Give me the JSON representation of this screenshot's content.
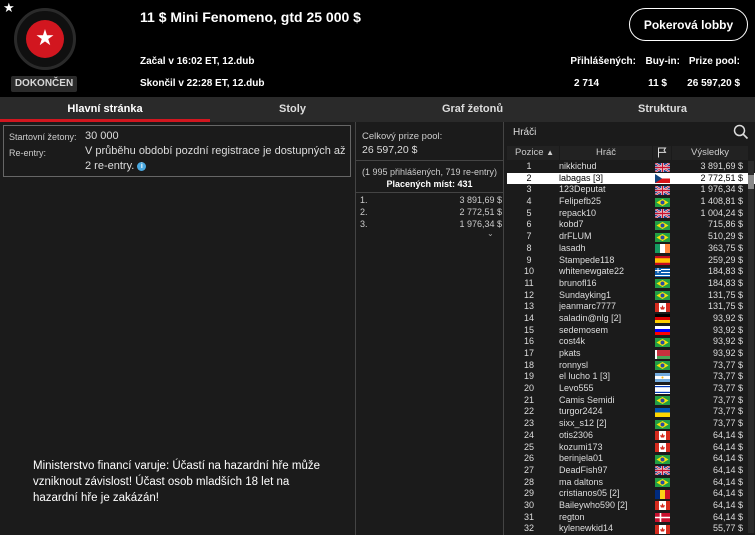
{
  "header": {
    "title": "11 $ Mini Fenomeno,  gtd 25 000 $",
    "status": "DOKONČEN",
    "started": "Začal v 16:02 ET, 12.dub",
    "ended": "Skončil v 22:28 ET, 12.dub",
    "lobby_button": "Pokerová lobby",
    "stats": {
      "registered_label": "Přihlášených:",
      "registered_value": "2 714",
      "buyin_label": "Buy-in:",
      "buyin_value": "11 $",
      "prizepool_label": "Prize pool:",
      "prizepool_value": "26 597,20 $"
    }
  },
  "tabs": [
    "Hlavní stránka",
    "Stoly",
    "Graf žetonů",
    "Struktura"
  ],
  "info": {
    "chips_label": "Startovní žetony:",
    "chips_value": "30 000",
    "reentry_label": "Re-entry:",
    "reentry_line1": "V průběhu období pozdní registrace je dostupných až",
    "reentry_line2": "2 re-entry."
  },
  "warning": "Ministerstvo financí varuje: Účastí na hazardní hře může vzniknout závislost! Účast osob mladších 18 let na hazardní hře je zakázán!",
  "prize_panel": {
    "title": "Celkový prize pool:",
    "amount": "26 597,20 $",
    "note": "(1 995 přihlášených, 719 re-entry)",
    "places": "Placených míst: 431",
    "rows": [
      {
        "rank": "1.",
        "value": "3 891,69 $"
      },
      {
        "rank": "2.",
        "value": "2 772,51 $"
      },
      {
        "rank": "3.",
        "value": "1 976,34 $"
      }
    ]
  },
  "players": {
    "title": "Hráči",
    "col_position": "Pozice",
    "col_player": "Hráč",
    "col_results": "Výsledky",
    "rows": [
      {
        "pos": "1",
        "name": "nikkichud",
        "flag": "gb",
        "prize": "3 891,69 $"
      },
      {
        "pos": "2",
        "name": "labagas [3]",
        "flag": "cz",
        "prize": "2 772,51 $"
      },
      {
        "pos": "3",
        "name": "123Deputat",
        "flag": "gb",
        "prize": "1 976,34 $"
      },
      {
        "pos": "4",
        "name": "Felipefb25",
        "flag": "br",
        "prize": "1 408,81 $"
      },
      {
        "pos": "5",
        "name": "repack10",
        "flag": "gb",
        "prize": "1 004,24 $"
      },
      {
        "pos": "6",
        "name": "kobd7",
        "flag": "br",
        "prize": "715,86 $"
      },
      {
        "pos": "7",
        "name": "drFLUM",
        "flag": "br",
        "prize": "510,29 $"
      },
      {
        "pos": "8",
        "name": "lasadh",
        "flag": "ie",
        "prize": "363,75 $"
      },
      {
        "pos": "9",
        "name": "Stampede118",
        "flag": "es",
        "prize": "259,29 $"
      },
      {
        "pos": "10",
        "name": "whitenewgate22",
        "flag": "gr",
        "prize": "184,83 $"
      },
      {
        "pos": "11",
        "name": "brunofl16",
        "flag": "br",
        "prize": "184,83 $"
      },
      {
        "pos": "12",
        "name": "Sundayking1",
        "flag": "br",
        "prize": "131,75 $"
      },
      {
        "pos": "13",
        "name": "jeanmarc7777",
        "flag": "ca",
        "prize": "131,75 $"
      },
      {
        "pos": "14",
        "name": "saladin@nlg [2]",
        "flag": "de",
        "prize": "93,92 $"
      },
      {
        "pos": "15",
        "name": "sedemosem",
        "flag": "si",
        "prize": "93,92 $"
      },
      {
        "pos": "16",
        "name": "cost4k",
        "flag": "br",
        "prize": "93,92 $"
      },
      {
        "pos": "17",
        "name": "pkats",
        "flag": "by",
        "prize": "93,92 $"
      },
      {
        "pos": "18",
        "name": "ronnysl",
        "flag": "br",
        "prize": "73,77 $"
      },
      {
        "pos": "19",
        "name": "el lucho 1 [3]",
        "flag": "ar",
        "prize": "73,77 $"
      },
      {
        "pos": "20",
        "name": "Levo555",
        "flag": "il",
        "prize": "73,77 $"
      },
      {
        "pos": "21",
        "name": "Camis Semidi",
        "flag": "br",
        "prize": "73,77 $"
      },
      {
        "pos": "22",
        "name": "turgor2424",
        "flag": "ua",
        "prize": "73,77 $"
      },
      {
        "pos": "23",
        "name": "sixx_s12 [2]",
        "flag": "br",
        "prize": "73,77 $"
      },
      {
        "pos": "24",
        "name": "otis2306",
        "flag": "ca",
        "prize": "64,14 $"
      },
      {
        "pos": "25",
        "name": "kozumi173",
        "flag": "ca",
        "prize": "64,14 $"
      },
      {
        "pos": "26",
        "name": "berinjela01",
        "flag": "br",
        "prize": "64,14 $"
      },
      {
        "pos": "27",
        "name": "DeadFish97",
        "flag": "gb",
        "prize": "64,14 $"
      },
      {
        "pos": "28",
        "name": "ma daltons",
        "flag": "br",
        "prize": "64,14 $"
      },
      {
        "pos": "29",
        "name": "cristianos05 [2]",
        "flag": "ro",
        "prize": "64,14 $"
      },
      {
        "pos": "30",
        "name": "Baileywho590 [2]",
        "flag": "ca",
        "prize": "64,14 $"
      },
      {
        "pos": "31",
        "name": "regton",
        "flag": "dk",
        "prize": "64,14 $"
      },
      {
        "pos": "32",
        "name": "kylenewkid14",
        "flag": "ca",
        "prize": "55,77 $"
      }
    ]
  },
  "colors": {
    "accent": "#d2161f",
    "background": "#1b1b1b",
    "header": "#000000"
  }
}
